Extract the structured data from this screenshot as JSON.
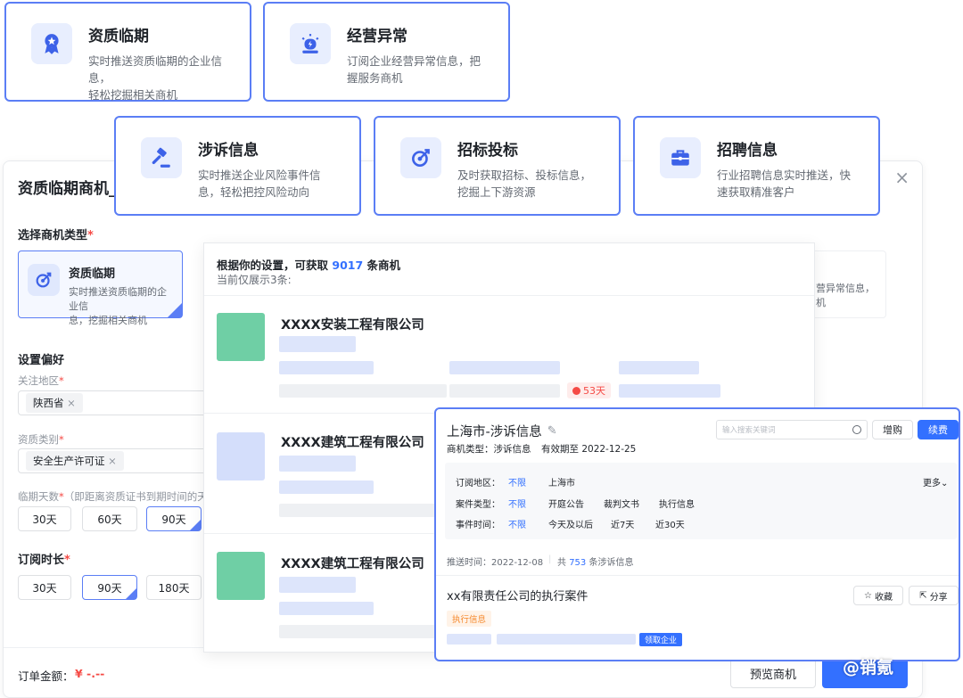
{
  "top_cards": [
    {
      "title": "资质临期",
      "desc1": "实时推送资质临期的企业信息，",
      "desc2": "轻松挖掘相关商机",
      "icon": "award-ribbon-icon"
    },
    {
      "title": "经营异常",
      "desc1": "订阅企业经营异常信息，把",
      "desc2": "握服务商机",
      "icon": "alarm-light-icon"
    },
    {
      "title": "涉诉信息",
      "desc1": "实时推送企业风险事件信",
      "desc2": "息，轻松把控风险动向",
      "icon": "gavel-icon"
    },
    {
      "title": "招标投标",
      "desc1": "及时获取招标、投标信息，",
      "desc2": "挖掘上下游资源",
      "icon": "target-icon"
    },
    {
      "title": "招聘信息",
      "desc1": "行业招聘信息实时推送，快",
      "desc2": "速获取精准客户",
      "icon": "briefcase-icon"
    }
  ],
  "panel": {
    "title": "资质临期商机_",
    "type_label": "选择商机类型",
    "type_card": {
      "title": "资质临期",
      "desc1": "实时推送资质临期的企业信",
      "desc2": "息，挖掘相关商机"
    },
    "right_partial1": "营异常信息，",
    "right_partial2": "机",
    "pref_label": "设置偏好",
    "region_label": "关注地区",
    "region_tag": "陕西省",
    "qual_label": "资质类别",
    "qual_tag": "安全生产许可证",
    "days_label": "临期天数",
    "days_hint": "（即距离资质证书到期时间的天数,",
    "days_opts": [
      "30天",
      "60天",
      "90天"
    ],
    "sub_label": "订阅时长",
    "sub_opts": [
      "30天",
      "90天",
      "180天"
    ],
    "order_label": "订单金额：",
    "order_value": "¥ -.--",
    "preview_btn": "预览商机",
    "tag_x": "×",
    "asterisk": "*"
  },
  "middle": {
    "summary_pre": "根据你的设置，可获取",
    "summary_count": "9017",
    "summary_post": " 条商机",
    "showing": "当前仅展示3条:",
    "companies": [
      "XXXX安装工程有限公司",
      "XXXX建筑工程有限公司",
      "XXXX建筑工程有限公司"
    ],
    "days_badge": "53天"
  },
  "right": {
    "title": "上海市-涉诉信息",
    "type": "商机类型：涉诉信息",
    "valid": "有效期至 2022-12-25",
    "search_placeholder": "输入搜索关键词",
    "btn_buy": "增购",
    "btn_renew": "续费",
    "filters": [
      {
        "label": "订阅地区：",
        "opts": [
          "不限",
          "上海市"
        ]
      },
      {
        "label": "案件类型：",
        "opts": [
          "不限",
          "开庭公告",
          "裁判文书",
          "执行信息"
        ]
      },
      {
        "label": "事件时间：",
        "opts": [
          "不限",
          "今天及以后",
          "近7天",
          "近30天"
        ]
      }
    ],
    "more": "更多",
    "push_time": "推送时间：2022-12-08",
    "total_pre": "共",
    "total_count": "753",
    "total_post": "条涉诉信息",
    "item_title": "xx有限责任公司的执行案件",
    "item_tag": "执行信息",
    "collect": "收藏",
    "share": "分享",
    "claim": "领取企业"
  },
  "watermark": "@销氪",
  "colors": {
    "accent": "#5b7ef5",
    "link": "#3370ff",
    "green_logo": "#6fcfa5",
    "badge_red": "#f54a45"
  }
}
